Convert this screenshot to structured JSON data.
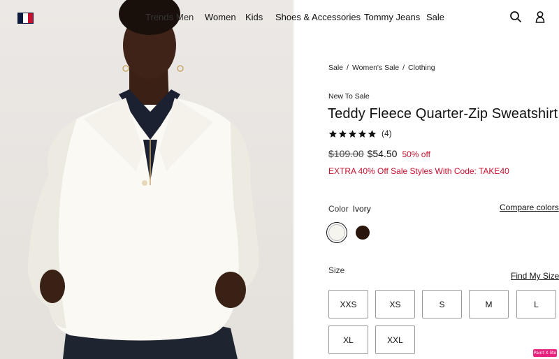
{
  "header": {
    "nav": [
      {
        "label": "Women"
      },
      {
        "label": "Kids"
      },
      {
        "label": "Shoes & Accessories"
      },
      {
        "label": "Tommy Jeans"
      },
      {
        "label": "Sale"
      }
    ],
    "nav_partial": [
      "Trends",
      "Men"
    ]
  },
  "breadcrumb": [
    "Sale",
    "Women's Sale",
    "Clothing"
  ],
  "product": {
    "tag": "New To Sale",
    "title": "Teddy Fleece Quarter-Zip Sweatshirt",
    "rating_stars": 5,
    "review_count": "(4)",
    "price_original": "$109.00",
    "price_sale": "$54.50",
    "discount": "50% off",
    "promo": "EXTRA 40% Off Sale Styles With Code: TAKE40"
  },
  "color": {
    "label": "Color",
    "selected": "Ivory",
    "compare_link": "Compare colors",
    "swatches": [
      {
        "name": "Ivory",
        "hex": "#f6f4ef"
      },
      {
        "name": "Brown",
        "hex": "#2a160d"
      }
    ]
  },
  "size": {
    "label": "Size",
    "find_link": "Find My Size",
    "options": [
      "XXS",
      "XS",
      "S",
      "M",
      "L",
      "XL",
      "XXL"
    ]
  },
  "badge": "Paint X lite",
  "colors": {
    "sale_red": "#c8102e",
    "text": "#111111",
    "border": "#9a9a9a"
  }
}
